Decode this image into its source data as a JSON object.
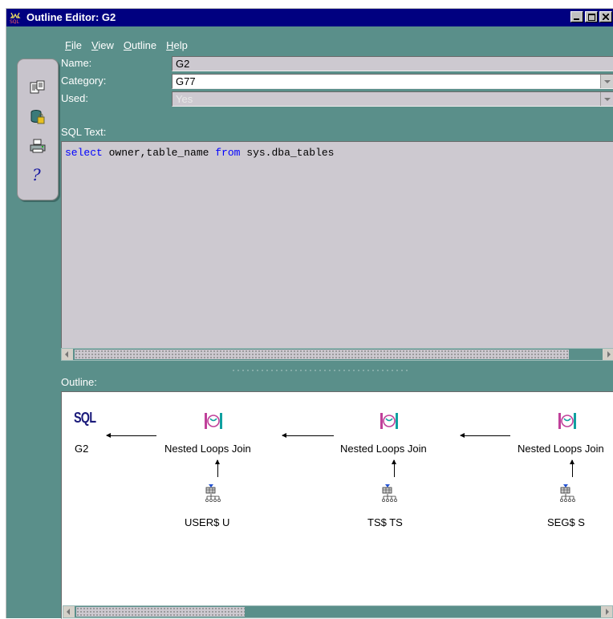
{
  "window": {
    "title": "Outline Editor: G2"
  },
  "menu": {
    "items": [
      {
        "label": "File",
        "accel": "F",
        "rest": "ile"
      },
      {
        "label": "View",
        "accel": "V",
        "rest": "iew"
      },
      {
        "label": "Outline",
        "accel": "O",
        "rest": "utline"
      },
      {
        "label": "Help",
        "accel": "H",
        "rest": "elp"
      }
    ]
  },
  "toolbar": {
    "icons": [
      "properties-icon",
      "database-lock-icon",
      "print-icon",
      "help-icon"
    ]
  },
  "form": {
    "name_label": "Name:",
    "name_value": "G2",
    "category_label": "Category:",
    "category_value": "G77",
    "used_label": "Used:",
    "used_value": "Yes",
    "sql_text_label": "SQL Text:"
  },
  "sql": {
    "kw_select": "select",
    "part1": " owner,table_name ",
    "kw_from": "from",
    "part2": " sys.dba_tables"
  },
  "outline": {
    "label": "Outline:",
    "root": {
      "icon_text": "SQL",
      "label": "G2"
    },
    "joins": [
      {
        "label": "Nested Loops Join",
        "table": "USER$ U"
      },
      {
        "label": "Nested Loops Join",
        "table": "TS$ TS"
      },
      {
        "label": "Nested Loops Join",
        "table": "SEG$ S"
      }
    ]
  },
  "colors": {
    "panel": "#5a8f8a",
    "titlebar": "#000080",
    "keyword": "#0000ff"
  }
}
